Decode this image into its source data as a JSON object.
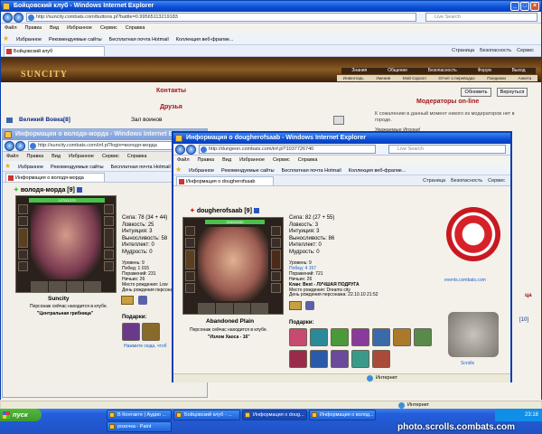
{
  "colors": {
    "xp_title": "#0a4dd6",
    "accent_red": "#a0161d",
    "desktop": "#d6d3ce",
    "taskbar": "#245edb",
    "start": "#3c9a2b"
  },
  "main_window": {
    "title": "Бойцовский клуб - Windows Internet Explorer",
    "url": "http://suncity.combats.com/buttons.pl?battle=0.99565113219183",
    "search_placeholder": "Live Search",
    "menu": [
      "Файл",
      "Правка",
      "Вид",
      "Избранное",
      "Сервис",
      "Справка"
    ],
    "favorites_label": "Избранное",
    "fav_links": [
      "Рекомендуемые сайты",
      "Бесплатная почта Hotmail",
      "Коллекция веб-фрагме..."
    ],
    "tab_label": "Бойцовский клуб",
    "commands": [
      "Страница",
      "Безопасность",
      "Сервис"
    ],
    "game_logo": "SUNCITY",
    "nav_top": [
      "Знания",
      "Общение",
      "Безопасность",
      "Форум",
      "Выход"
    ],
    "nav_bottom": [
      "Инвентарь",
      "Умения",
      "Мой Скролл",
      "Отчет о переводах",
      "Поединки",
      "Анкета"
    ],
    "contacts_title": "Контакты",
    "friends_title": "Друзья",
    "friend_name": "Великий Вовка",
    "friend_level": "[8]",
    "friend_location": "Зал воинов",
    "refresh_btn": "Обновить",
    "back_btn": "Вернуться",
    "moderators_title": "Модераторы on-line",
    "moderators_text": "К сожалению в данный момент никого из модераторов нет в городе.",
    "respected_label": "Уважаемые Игроки!",
    "right_fragment_1": "цa",
    "right_fragment_2": "[10]"
  },
  "profile1": {
    "title": "Информация о володя-морда - Windows Internet Explorer",
    "url": "http://suncity.combats.com/inf.pl?login=володя-морда",
    "search_placeholder": "Live Search",
    "menu": [
      "Файл",
      "Правка",
      "Вид",
      "Избранное",
      "Сервис",
      "Справка"
    ],
    "favorites_label": "Избранное",
    "fav_links": [
      "Рекомендуемые сайты",
      "Бесплатная почта Hotmail"
    ],
    "tab_label": "Информация о володя-морда",
    "char_name": "володя-морда",
    "level": "[9]",
    "hp": "1270/1270",
    "stats": [
      "Сила: 78 (34 + 44)",
      "Ловкость: 25",
      "Интуиция: 3",
      "Выносливость: 58",
      "Интеллект: 0",
      "Мудрость: 0"
    ],
    "info": [
      "Уровень: 9",
      "Побед: 1 015",
      "Поражений: 231",
      "Ничьих: 26",
      "Место рождения: Low",
      "День рождения персонажа:"
    ],
    "location_name": "Suncity",
    "presence": "Персонаж сейчас находится в клубе.",
    "room": "\"Центральная грибница\"",
    "gifts_label": "Подарки:",
    "gift_link": "Нажмите сюда, чтоб"
  },
  "profile2": {
    "title": "Информация о dougherofsaab - Windows Internet Explorer",
    "url": "http://dungeon.combats.com/inf.pl?1037726740",
    "search_placeholder": "Live Search",
    "menu": [
      "Файл",
      "Правка",
      "Вид",
      "Избранное",
      "Сервис",
      "Справка"
    ],
    "favorites_label": "Избранное",
    "fav_links": [
      "Рекомендуемые сайты",
      "Бесплатная почта Hotmail",
      "Коллекция веб-фрагме..."
    ],
    "tab_label": "Информация о dougherofsaab",
    "commands": [
      "Страница",
      "Безопасность",
      "Сервис"
    ],
    "char_name": "dougherofsaab",
    "level": "[9]",
    "hp": "2040/2040",
    "stats": [
      "Сила: 82 (27 + 55)",
      "Ловкость: 3",
      "Интуиция: 3",
      "Выносливость: 86",
      "Интеллект: 0",
      "Мудрость: 0"
    ],
    "info": [
      "Уровень: 9",
      "Побед: 4 157",
      "Поражений: 721",
      "Ничьих: 26",
      "Клан: Best - ЛУЧШАЯ ПОДРУГА",
      "Место рождения: Dreams city",
      "День рождения персонажа: 22.10.10 21:52"
    ],
    "location_name": "Abandoned Plain",
    "presence": "Персонаж сейчас находится в клубе.",
    "room": "\"Излом Хаоса - 16\"",
    "gifts_label": "Подарки:",
    "site_link": "events.combats.com",
    "scrolls_label": "Scrolls",
    "status_text": "Интернет"
  },
  "main_status": "Интернет",
  "taskbar": {
    "start": "пуск",
    "items": [
      "В Контакте | Аудио ...",
      "Бойцовский клуб - ...",
      "Информация о doug...",
      "Информация о волод..."
    ],
    "items_row2": [
      "розочка - Paint"
    ],
    "clock": "23:18",
    "watermark": "photo.scrolls.combats.com"
  }
}
